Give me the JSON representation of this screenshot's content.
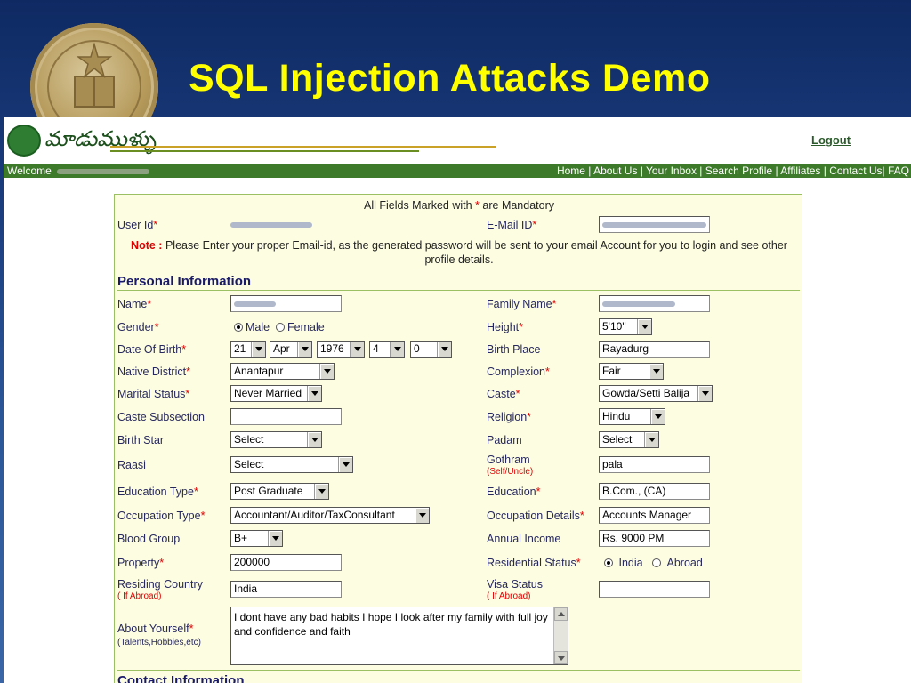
{
  "slide": {
    "title": "SQL Injection Attacks Demo"
  },
  "header": {
    "logo_text": "మాడుముళ్ళు",
    "logout": "Logout"
  },
  "navbar": {
    "welcome": "Welcome",
    "links": [
      "Home",
      "About Us",
      "Your Inbox",
      "Search Profile",
      "Affiliates",
      "Contact Us| FAQ"
    ]
  },
  "form": {
    "mandatory_prefix": "All Fields Marked with",
    "mandatory_star": "*",
    "mandatory_suffix": "are Mandatory",
    "star": "*",
    "user_id_label": "User Id",
    "email_label": "E-Mail ID",
    "note_label": "Note :",
    "note_text": "Please Enter your proper Email-id, as the generated password will be sent to your email Account for you to login and see other profile details.",
    "personal_section": "Personal Information",
    "contact_section": "Contact Information",
    "name_label": "Name",
    "family_name_label": "Family Name",
    "gender_label": "Gender",
    "gender_male": "Male",
    "gender_female": "Female",
    "height_label": "Height",
    "height_value": "5'10\"",
    "dob_label": "Date Of Birth",
    "dob_day": "21",
    "dob_month": "Apr",
    "dob_year": "1976",
    "dob_hour": "4",
    "dob_min": "0",
    "birth_place_label": "Birth Place",
    "birth_place_value": "Rayadurg",
    "native_district_label": "Native District",
    "native_district_value": "Anantapur",
    "complexion_label": "Complexion",
    "complexion_value": "Fair",
    "marital_label": "Marital Status",
    "marital_value": "Never Married",
    "caste_label": "Caste",
    "caste_value": "Gowda/Setti Balija",
    "caste_sub_label": "Caste Subsection",
    "religion_label": "Religion",
    "religion_value": "Hindu",
    "birth_star_label": "Birth Star",
    "birth_star_value": "Select",
    "padam_label": "Padam",
    "padam_value": "Select",
    "raasi_label": "Raasi",
    "raasi_value": "Select",
    "gothram_label": "Gothram",
    "gothram_sub": "(Self/Uncle)",
    "gothram_value": "pala",
    "edu_type_label": "Education Type",
    "edu_type_value": "Post Graduate",
    "education_label": "Education",
    "education_value": "B.Com., (CA)",
    "occ_type_label": "Occupation Type",
    "occ_type_value": "Accountant/Auditor/TaxConsultant",
    "occ_details_label": "Occupation Details",
    "occ_details_value": "Accounts Manager",
    "blood_label": "Blood Group",
    "blood_value": "B+",
    "income_label": "Annual Income",
    "income_value": "Rs. 9000 PM",
    "property_label": "Property",
    "property_value": "200000",
    "residential_label": "Residential Status",
    "res_india": "India",
    "res_abroad": "Abroad",
    "residing_label": "Residing Country",
    "residing_sub": "( If Abroad)",
    "residing_value": "India",
    "visa_label": "Visa Status",
    "visa_sub": "( If Abroad)",
    "about_label": "About Yourself",
    "about_sub": "(Talents,Hobbies,etc)",
    "about_value": "I dont have any bad habits I hope I look after my family with full joy and confidence and faith"
  }
}
